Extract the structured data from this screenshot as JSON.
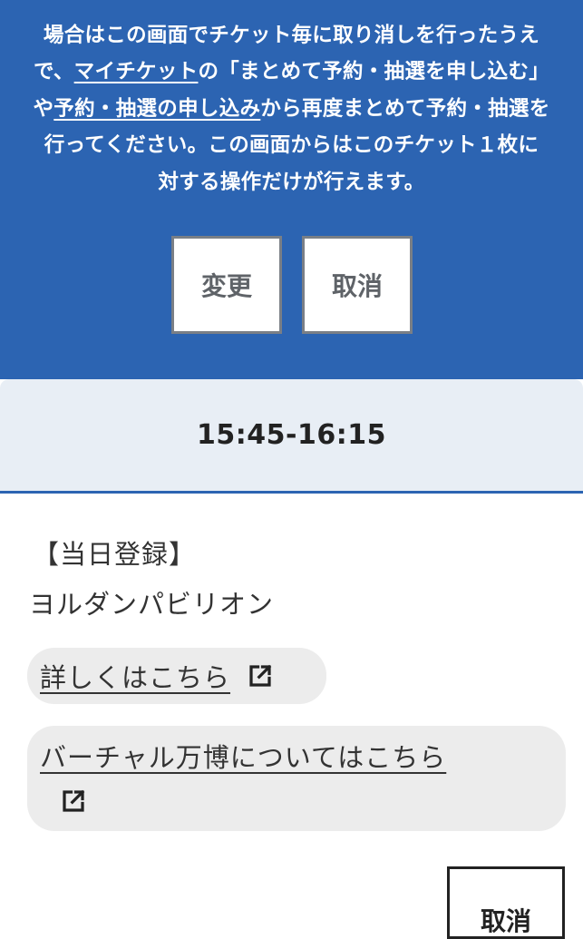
{
  "notice": {
    "line1": "場合はこの画面でチケット毎に取り消しを行ったうえ",
    "line2_pre": "で、",
    "line2_link": "マイチケット",
    "line2_post": "の「まとめて予約・抽選を申し込む」",
    "line3_pre": "や",
    "line3_link": "予約・抽選の申し込み",
    "line3_post": "から再度まとめて予約・抽選を",
    "line4": "行ってください。この画面からはこのチケット１枚に",
    "line5": "対する操作だけが行えます。"
  },
  "actions": {
    "change_label": "変更",
    "cancel_label": "取消"
  },
  "slot": {
    "time": "15:45-16:15",
    "category": "【当日登録】",
    "pavilion": "ヨルダンパビリオン",
    "detail_link": "詳しくはこちら",
    "virtual_link": "バーチャル万博についてはこちら",
    "cancel_label": "取消"
  },
  "icons": {
    "external": "external-link-icon"
  },
  "colors": {
    "brand_blue": "#2c64b2",
    "band_bg": "#e8eef5"
  }
}
